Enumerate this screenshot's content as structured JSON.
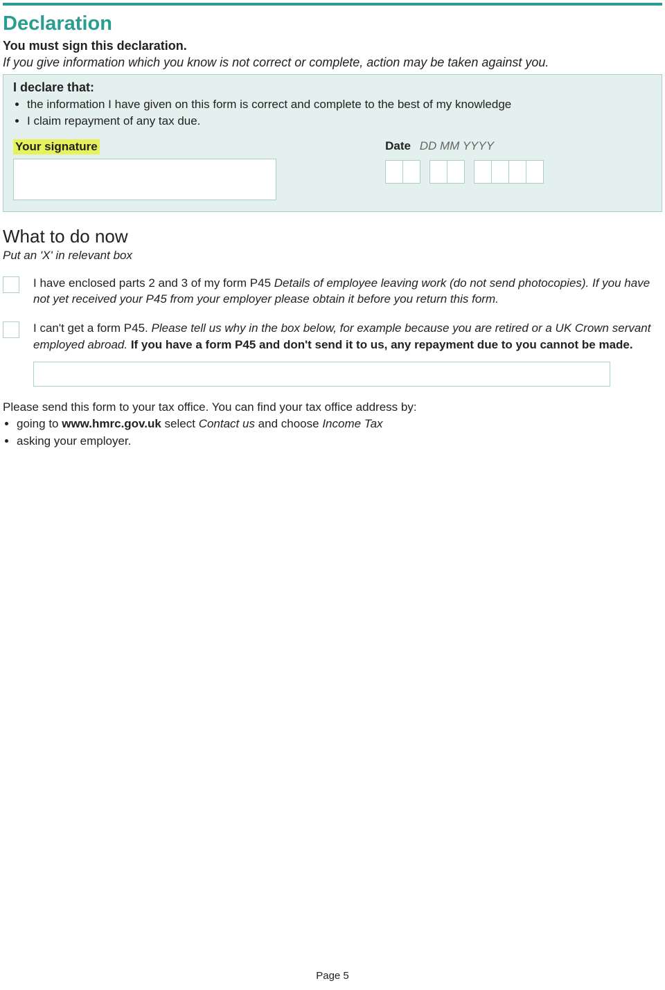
{
  "declaration": {
    "title": "Declaration",
    "mustSign": "You must sign this declaration.",
    "warning": "If you give information which you know is not correct or complete, action may be taken against you.",
    "declareHead": "I declare that:",
    "bullet1": "the information I have given on this form is correct and complete to the best of my knowledge",
    "bullet2": "I claim repayment of any tax due.",
    "sigLabel": "Your signature",
    "dateLabel": "Date",
    "dateHint": "DD MM YYYY"
  },
  "whatToDo": {
    "title": "What to do now",
    "subtitle": "Put an 'X' in relevant box",
    "opt1_a": "I have enclosed parts 2 and 3 of my form P45 ",
    "opt1_b": "Details of employee leaving work (do not send photocopies). If you have not yet received your P45 from your employer please obtain it before you return this form.",
    "opt2_a": "I can't get a form P45. ",
    "opt2_b": "Please tell us why in the box below, for example because you are retired or a UK Crown servant employed abroad. ",
    "opt2_c": "If you have a form P45 and don't send it to us, any repayment due to you cannot be made."
  },
  "send": {
    "intro": "Please send this form to your tax office. You can find your tax office address by:",
    "b1_a": "going to ",
    "b1_b": "www.hmrc.gov.uk",
    "b1_c": " select ",
    "b1_d": "Contact us",
    "b1_e": " and choose ",
    "b1_f": "Income Tax",
    "b2": "asking your employer."
  },
  "pageNum": "Page 5"
}
